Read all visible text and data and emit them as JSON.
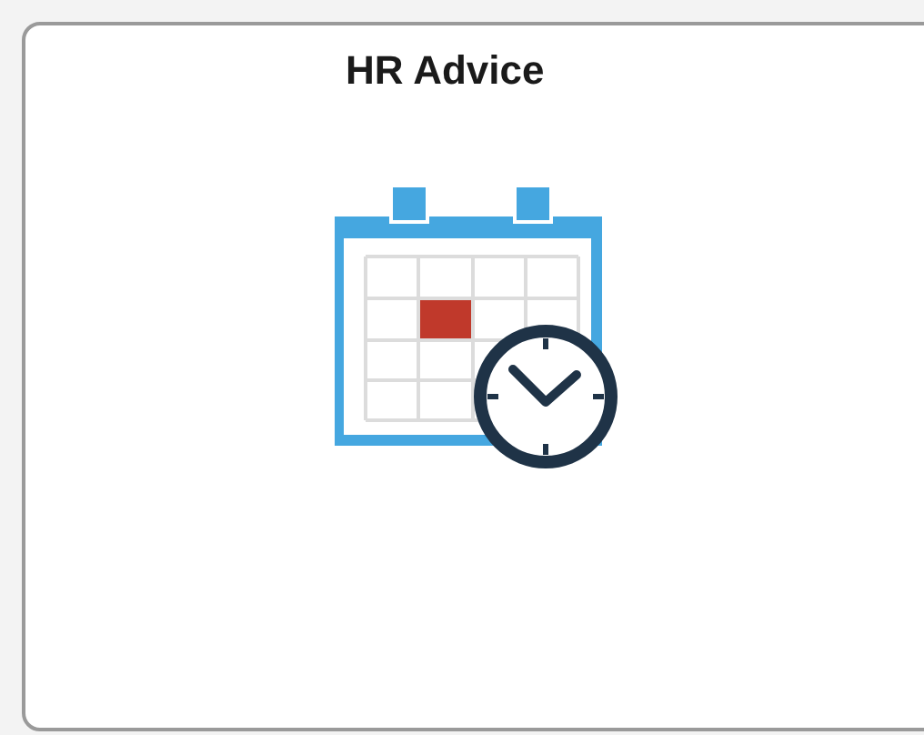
{
  "tile": {
    "title": "HR Advice"
  }
}
